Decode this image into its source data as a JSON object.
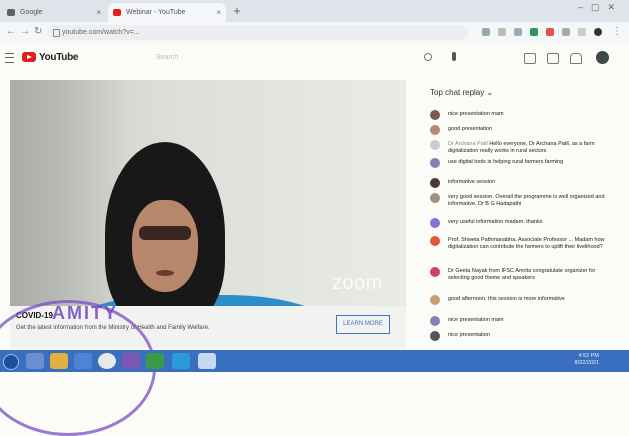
{
  "browser": {
    "tabs": [
      {
        "label": "Google",
        "favicon_color": "#5f6368"
      },
      {
        "label": "Webinar - YouTube",
        "favicon_color": "#e02020"
      }
    ],
    "url": "youtube.com/watch?v=..."
  },
  "header": {
    "logo_text": "YouTube",
    "search_placeholder": "Search"
  },
  "video": {
    "watermark": "zoom",
    "banner": {
      "title": "COVID-19",
      "subtitle": "Get the latest information from the Ministry of Health and Family Welfare.",
      "cta": "LEARN MORE"
    }
  },
  "chat": {
    "header": "Top chat replay",
    "messages": [
      {
        "name": "",
        "text": "nice presentation mam",
        "avatar": "#7d5a4a"
      },
      {
        "name": "",
        "text": "good presentation",
        "avatar": "#b58a6e"
      },
      {
        "name": "Dr Archana Patil",
        "text": "Hello everyone, Dr Archana Patil, as a farm digitalization really works in rural sectors",
        "avatar": "#cccccc"
      },
      {
        "name": "",
        "text": "use digital tools is helping rural farmers farming",
        "avatar": "#8a7fb5"
      },
      {
        "name": "",
        "text": "informative session",
        "avatar": "#4a3b35"
      },
      {
        "name": "",
        "text": "very good session. Overall the programme is well organized and informative. Dr B G Hadapathi",
        "avatar": "#a09080"
      },
      {
        "name": "",
        "text": "very useful information madam. thanks",
        "avatar": "#8c6fd0"
      },
      {
        "name": "",
        "text": "Prof. Shweta Pathmanabha, Associate Professor ... Madam how digitalization can contribute the farmers to uplift their livelihood?",
        "avatar": "#e05a3a"
      },
      {
        "name": "",
        "text": "Dr Geeta Nayak from IFSC Amrita congratulate organizer for selecting good theme and speakers",
        "avatar": "#d04060"
      },
      {
        "name": "",
        "text": "good afternoon. this session is more informative",
        "avatar": "#c8a070"
      },
      {
        "name": "",
        "text": "nice presentation mam",
        "avatar": "#8a7fb5"
      },
      {
        "name": "",
        "text": "nice presentation",
        "avatar": "#555555"
      }
    ]
  },
  "stamp": {
    "text": "AMITY"
  },
  "taskbar": {
    "time": "4:52 PM",
    "date": "8/22/2021"
  }
}
